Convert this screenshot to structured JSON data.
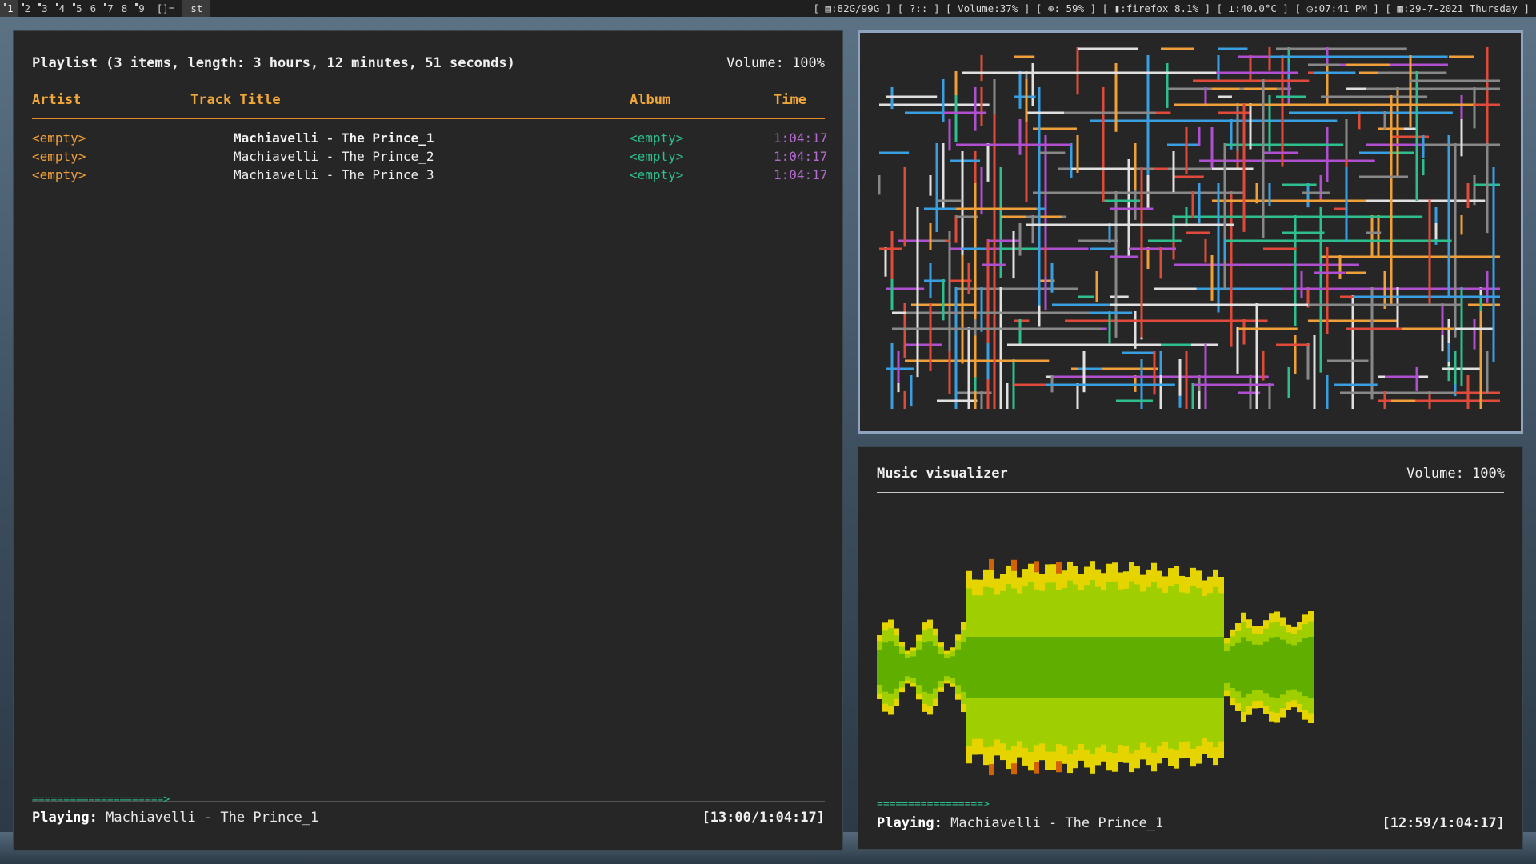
{
  "topbar": {
    "tags": [
      "1",
      "2",
      "3",
      "4",
      "5",
      "6",
      "7",
      "8",
      "9"
    ],
    "tags_with_clients": [
      "1",
      "2",
      "3",
      "4",
      "5",
      "7",
      "9"
    ],
    "selected_tag": "1",
    "layout_symbol": "[]=",
    "window_title": "st",
    "status": "[ ▤:82G/99G ] [ ?:: ] [ Volume:37% ] [ ⊕: 59% ] [ ▮:firefox  8.1% ] [ ⊥:40.0°C ] [ ◷:07:41 PM ] [ ▦:29-7-2021 Thursday ]"
  },
  "playlist": {
    "header": "Playlist (3 items, length: 3 hours, 12 minutes, 51 seconds)",
    "volume": "Volume: 100%",
    "columns": {
      "artist": "Artist",
      "title": "Track Title",
      "album": "Album",
      "time": "Time"
    },
    "rows": [
      {
        "artist": "<empty>",
        "title": "Machiavelli - The Prince_1",
        "album": "<empty>",
        "time": "1:04:17"
      },
      {
        "artist": "<empty>",
        "title": "Machiavelli - The Prince_2",
        "album": "<empty>",
        "time": "1:04:17"
      },
      {
        "artist": "<empty>",
        "title": "Machiavelli - The Prince_3",
        "album": "<empty>",
        "time": "1:04:17"
      }
    ],
    "progress": "=====================>",
    "playing_label": "Playing:",
    "playing_track": "Machiavelli - The Prince_1",
    "position": "[13:00/1:04:17]"
  },
  "visualizer": {
    "header": "Music visualizer",
    "volume": "Volume: 100%",
    "progress": "=================>",
    "playing_label": "Playing:",
    "playing_track": "Machiavelli - The Prince_1",
    "position": "[12:59/1:04:17]",
    "colors": {
      "low": "#5fae00",
      "mid": "#9fcf00",
      "high": "#e6d400",
      "peak": "#e56a00"
    }
  },
  "pipes_colors": [
    "#e0e0e0",
    "#2fbf8f",
    "#f0a03a",
    "#b04fd0",
    "#3a9fe0",
    "#e04a3a",
    "#888888"
  ]
}
